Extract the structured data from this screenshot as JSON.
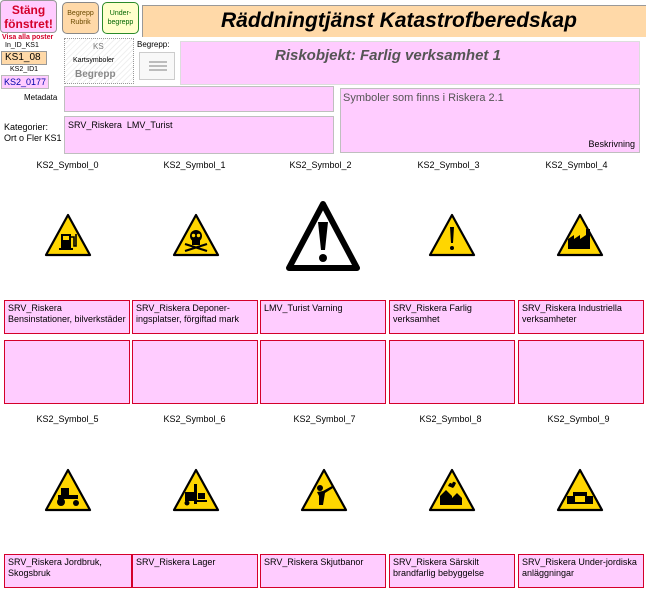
{
  "header": {
    "close_button": "Stäng fönstret!",
    "show_all_posts": "Visa alla poster",
    "in_id_label": "In_ID_KS1",
    "in_id_value": "KS1_08",
    "ks2_id_label": "KS2_ID1",
    "ks2_id_value": "KS2_0177",
    "begrepp_rubrik_button": "Begrepp Rubrik",
    "under_begrepp_button": "Under-begrepp",
    "ks_label": "KS",
    "kartsymboler_label": "Kartsymboler",
    "begrepp_mark": "Begrepp",
    "begrepp_field_label": "Begrepp:",
    "title": "Räddningtjänst Katastrofberedskap",
    "subtitle": "Riskobjekt: Farlig verksamhet 1"
  },
  "meta": {
    "metadata_label": "Metadata",
    "kategorier_label": "Kategorier:",
    "kategorier_sub": "Ort o Fler KS1",
    "kategorier_value": "SRV_Riskera  LMV_Turist",
    "symbol_info": "Symboler som finns i Riskera 2.1",
    "beskrivning_label": "Beskrivning"
  },
  "symbols_row1": [
    {
      "label": "KS2_Symbol_0",
      "desc": "SRV_Riskera Bensinstationer, bilverkstäder",
      "icon": "gas-station-icon"
    },
    {
      "label": "KS2_Symbol_1",
      "desc": "SRV_Riskera  Deponer-ingsplatser, förgiftad mark",
      "icon": "skull-crossbones-icon"
    },
    {
      "label": "KS2_Symbol_2",
      "desc": "LMV_Turist Varning",
      "icon": "warning-icon"
    },
    {
      "label": "KS2_Symbol_3",
      "desc": "SRV_Riskera Farlig verksamhet",
      "icon": "exclamation-icon"
    },
    {
      "label": "KS2_Symbol_4",
      "desc": "SRV_Riskera  Industriella verksamheter",
      "icon": "factory-icon"
    }
  ],
  "symbols_row2": [
    {
      "label": "KS2_Symbol_5",
      "desc": "SRV_Riskera Jordbruk, Skogsbruk",
      "icon": "tractor-icon"
    },
    {
      "label": "KS2_Symbol_6",
      "desc": "SRV_Riskera  Lager",
      "icon": "forklift-icon"
    },
    {
      "label": "KS2_Symbol_7",
      "desc": "SRV_Riskera  Skjutbanor",
      "icon": "shooter-icon"
    },
    {
      "label": "KS2_Symbol_8",
      "desc": "SRV_Riskera  Särskilt brandfarlig bebyggelse",
      "icon": "burning-building-icon"
    },
    {
      "label": "KS2_Symbol_9",
      "desc": "SRV_Riskera  Under-jordiska anläggningar",
      "icon": "tunnel-icon"
    }
  ],
  "colors": {
    "pink": "#ffccff",
    "red_border": "#d4002a",
    "sign_yellow": "#ffd600",
    "title_bg": "#ffd9a8"
  }
}
